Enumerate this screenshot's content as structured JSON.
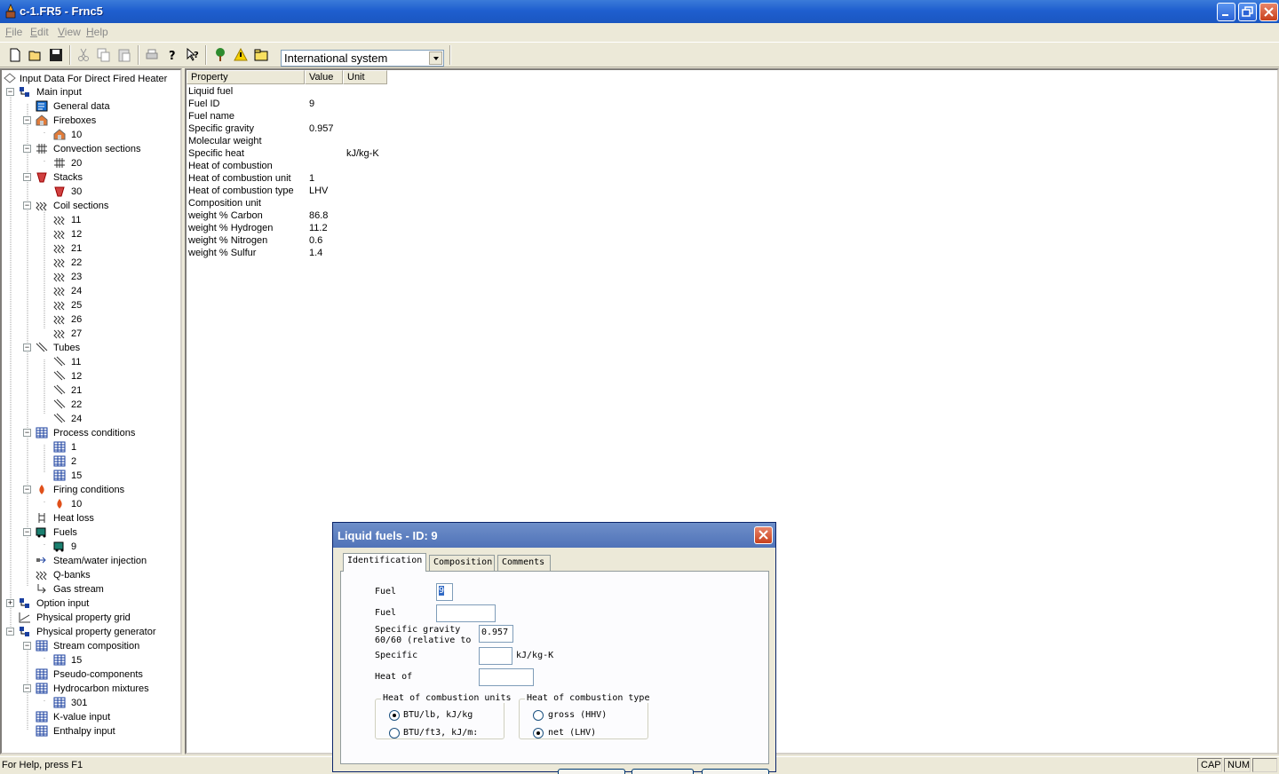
{
  "window": {
    "title": "c-1.FR5 - Frnc5"
  },
  "menu": [
    {
      "accel": "F",
      "rest": "ile"
    },
    {
      "accel": "E",
      "rest": "dit"
    },
    {
      "accel": "V",
      "rest": "iew"
    },
    {
      "accel": "H",
      "rest": "elp"
    }
  ],
  "toolbar": {
    "unit_system": "International system"
  },
  "tree": {
    "root": "Input Data For Direct Fired Heater",
    "main_input": "Main input",
    "general_data": "General data",
    "fireboxes": "Fireboxes",
    "firebox_10": "10",
    "convection_sections": "Convection sections",
    "convection_20": "20",
    "stacks": "Stacks",
    "stack_30": "30",
    "coil_sections": "Coil sections",
    "coils": [
      "11",
      "12",
      "21",
      "22",
      "23",
      "24",
      "25",
      "26",
      "27"
    ],
    "tubes": "Tubes",
    "tube_items": [
      "11",
      "12",
      "21",
      "22",
      "24"
    ],
    "process_conditions": "Process conditions",
    "process_items": [
      "1",
      "2",
      "15"
    ],
    "firing_conditions": "Firing conditions",
    "firing_10": "10",
    "heat_loss": "Heat loss",
    "fuels": "Fuels",
    "fuel_9": "9",
    "steam_water_injection": "Steam/water injection",
    "q_banks": "Q-banks",
    "gas_stream": "Gas stream",
    "option_input": "Option input",
    "physical_property_grid": "Physical property grid",
    "physical_property_generator": "Physical property generator",
    "stream_composition": "Stream composition",
    "stream_15": "15",
    "pseudo_components": "Pseudo-components",
    "hydrocarbon_mixtures": "Hydrocarbon mixtures",
    "mixture_301": "301",
    "k_value_input": "K-value input",
    "enthalpy_input": "Enthalpy input"
  },
  "grid": {
    "headers": [
      "Property",
      "Value",
      "Unit"
    ],
    "rows": [
      {
        "property": "Liquid fuel",
        "value": "",
        "unit": ""
      },
      {
        "property": "Fuel ID",
        "value": "9",
        "unit": ""
      },
      {
        "property": "Fuel name",
        "value": "",
        "unit": ""
      },
      {
        "property": "Specific gravity",
        "value": "0.957",
        "unit": ""
      },
      {
        "property": "Molecular weight",
        "value": "",
        "unit": ""
      },
      {
        "property": "Specific heat",
        "value": "",
        "unit": "kJ/kg-K"
      },
      {
        "property": "Heat of combustion",
        "value": "",
        "unit": ""
      },
      {
        "property": "Heat of combustion unit",
        "value": "1",
        "unit": ""
      },
      {
        "property": "Heat of combustion type",
        "value": "LHV",
        "unit": ""
      },
      {
        "property": "Composition unit",
        "value": "",
        "unit": ""
      },
      {
        "property": "weight % Carbon",
        "value": "86.8",
        "unit": ""
      },
      {
        "property": "weight % Hydrogen",
        "value": "11.2",
        "unit": ""
      },
      {
        "property": "weight % Nitrogen",
        "value": "0.6",
        "unit": ""
      },
      {
        "property": "weight % Sulfur",
        "value": "1.4",
        "unit": ""
      }
    ]
  },
  "status": {
    "help": "For Help, press F1",
    "cap": "CAP",
    "num": "NUM"
  },
  "dialog": {
    "title": "Liquid fuels - ID: 9",
    "tabs": [
      "Identification",
      "Composition",
      "Comments"
    ],
    "fuel_id_label": "Fuel",
    "fuel_id_value": "9",
    "fuel_name_label": "Fuel",
    "fuel_name_value": "",
    "sg_label_1": "Specific gravity",
    "sg_label_2": "60/60 (relative to",
    "sg_value": "0.957",
    "sh_label": "Specific",
    "sh_value": "",
    "sh_unit": "kJ/kg-K",
    "hoc_label": "Heat of",
    "hoc_value": "",
    "units_group": "Heat of combustion units",
    "unit_opt1": "BTU/lb, kJ/kg",
    "unit_opt2": "BTU/ft3, kJ/m:",
    "type_group": "Heat of combustion type",
    "type_opt1": "gross (HHV)",
    "type_opt2": "net (LHV)",
    "selected_unit": "BTU/lb, kJ/kg",
    "selected_type": "net (LHV)"
  },
  "colors": {
    "titlebar": "#1f5fcf",
    "face": "#ece9d8",
    "selection_text": "#316ac5"
  }
}
